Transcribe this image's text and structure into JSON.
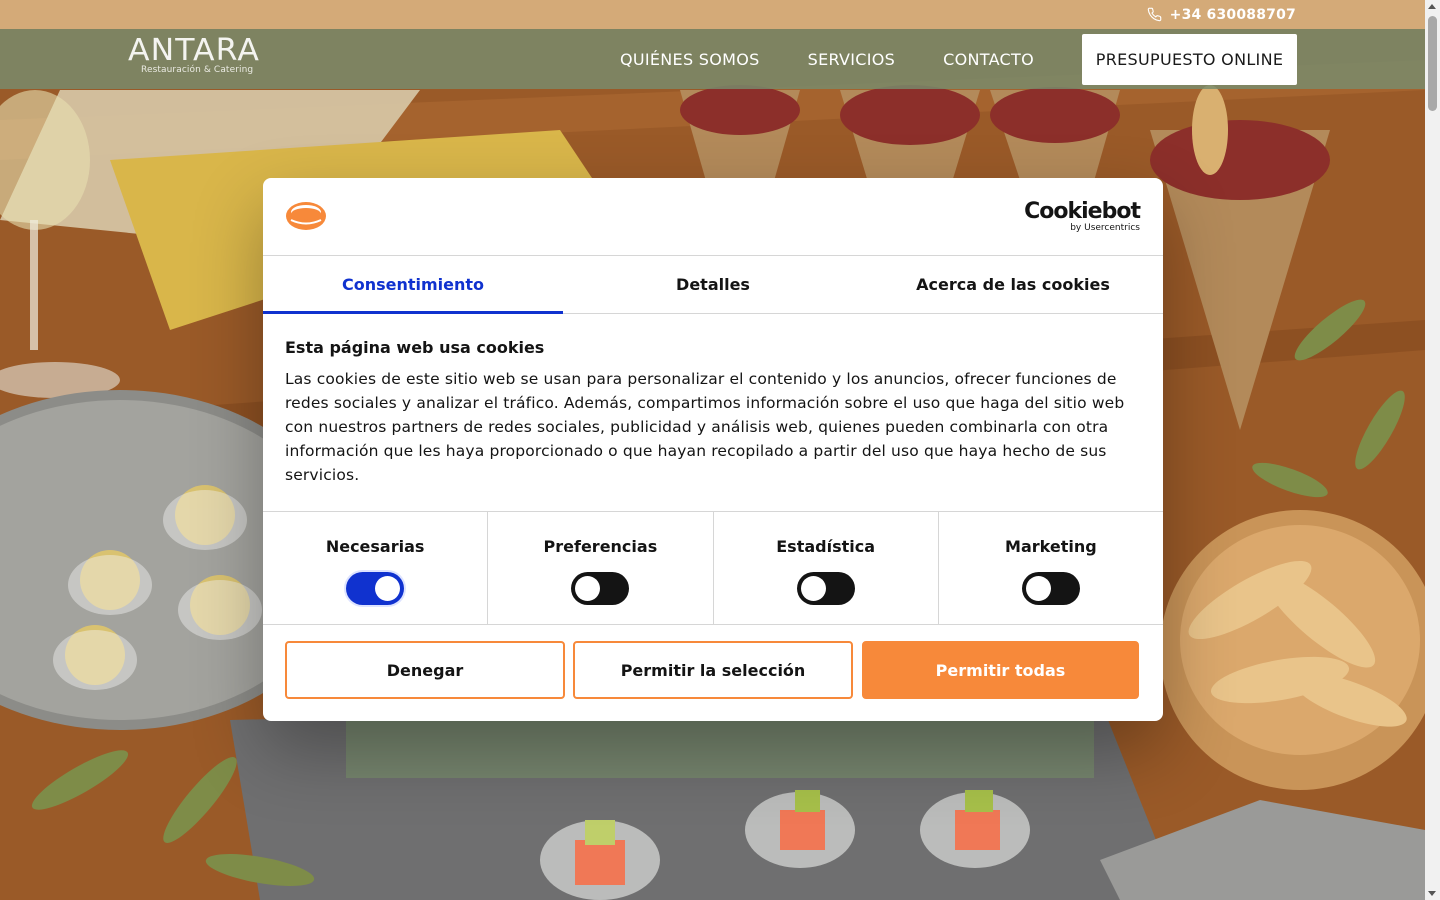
{
  "topbar": {
    "phone": "+34 630088707",
    "phone_icon": "phone-icon"
  },
  "header": {
    "logo_main": "ANTARA",
    "logo_sub": "Restauración & Catering",
    "nav": [
      "QUIÉNES SOMOS",
      "SERVICIOS",
      "CONTACTO"
    ],
    "cta": "PRESUPUESTO ONLINE"
  },
  "dialog": {
    "provider_logo": "Cookiebot",
    "provider_sub": "by Usercentrics",
    "tabs": [
      {
        "label": "Consentimiento",
        "active": true
      },
      {
        "label": "Detalles",
        "active": false
      },
      {
        "label": "Acerca de las cookies",
        "active": false
      }
    ],
    "title": "Esta página web usa cookies",
    "text": "Las cookies de este sitio web se usan para personalizar el contenido y los anuncios, ofrecer funciones de redes sociales y analizar el tráfico. Además, compartimos información sobre el uso que haga del sitio web con nuestros partners de redes sociales, publicidad y análisis web, quienes pueden combinarla con otra información que les haya proporcionado o que hayan recopilado a partir del uso que haya hecho de sus servicios.",
    "categories": [
      {
        "label": "Necesarias",
        "checked": true
      },
      {
        "label": "Preferencias",
        "checked": false
      },
      {
        "label": "Estadística",
        "checked": false
      },
      {
        "label": "Marketing",
        "checked": false
      }
    ],
    "buttons": {
      "deny": "Denegar",
      "allow_selection": "Permitir la selección",
      "allow_all": "Permitir todas"
    }
  },
  "colors": {
    "topbar": "#d4aa78",
    "navbar": "#788c6e",
    "accent_blue": "#1032cf",
    "accent_orange": "#f7893a"
  }
}
